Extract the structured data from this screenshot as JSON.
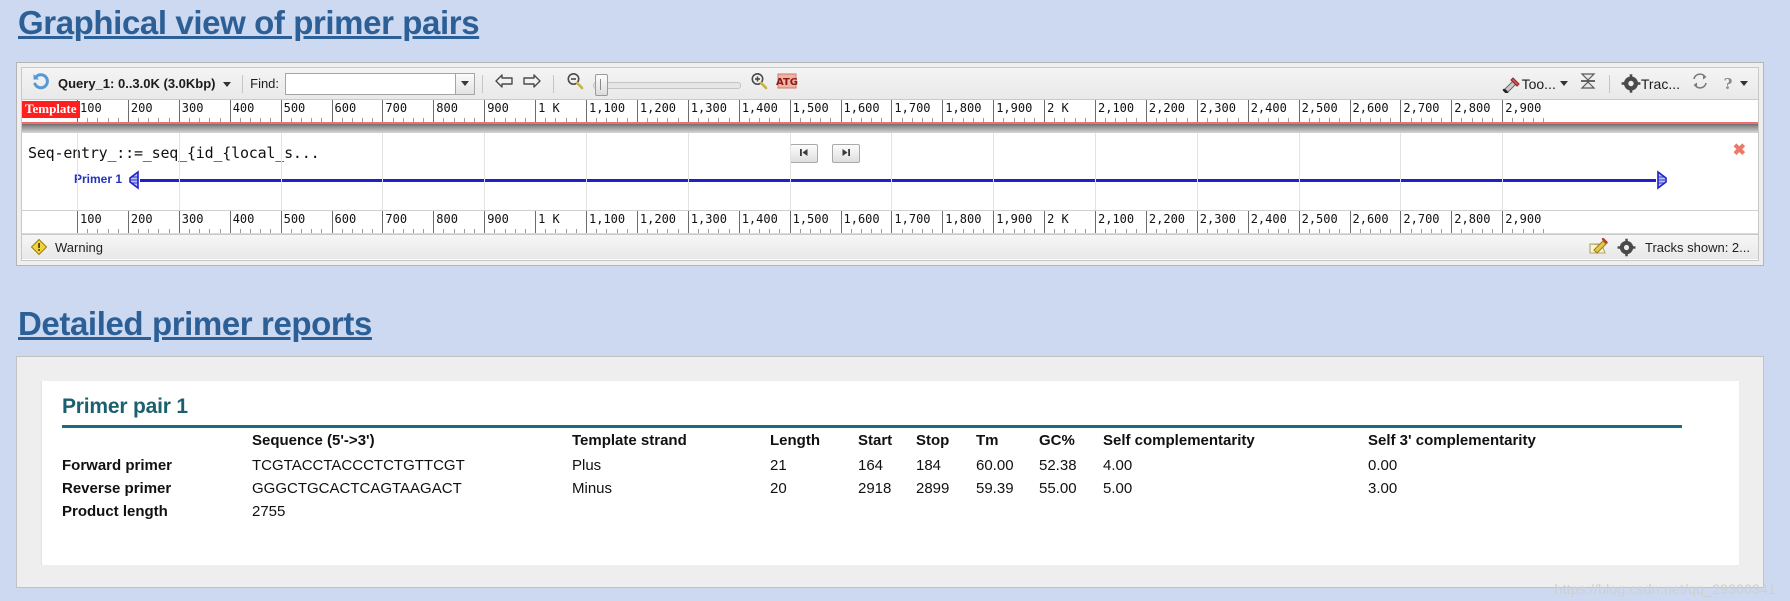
{
  "headings": {
    "graphical": "Graphical view of primer pairs",
    "reports": "Detailed primer reports"
  },
  "viewer": {
    "toolbar": {
      "back_icon": "undo-arrow-icon",
      "query_label": "Query_1: 0..3.0K (3.0Kbp)",
      "find_label": "Find:",
      "find_value": "",
      "find_placeholder": "",
      "prev_icon": "arrow-left-icon",
      "next_icon": "arrow-right-icon",
      "zoom_out_icon": "zoom-out-icon",
      "zoom_in_icon": "zoom-in-icon",
      "zoom_seq_icon": "atg-sequence-icon",
      "tools_label": "Too...",
      "tools_icon": "hammer-wrench-icon",
      "collapse_icon": "collapse-rows-icon",
      "tracks_label": "Trac...",
      "tracks_icon": "gear-icon",
      "reload_icon": "reload-icon",
      "help_icon": "question-mark-icon"
    },
    "ruler": {
      "template_badge": "Template",
      "ticks": [
        "100",
        "200",
        "300",
        "400",
        "500",
        "600",
        "700",
        "800",
        "900",
        "1 K",
        "1,100",
        "1,200",
        "1,300",
        "1,400",
        "1,500",
        "1,600",
        "1,700",
        "1,800",
        "1,900",
        "2 K",
        "2,100",
        "2,200",
        "2,300",
        "2,400",
        "2,500",
        "2,600",
        "2,700",
        "2,800",
        "2,900"
      ]
    },
    "graph": {
      "sequence_title": "Seq-entry_::=_seq_{id_{local_s...",
      "nav_first_icon": "step-backward-icon",
      "nav_next_icon": "step-forward-icon",
      "close_icon": "close-x-icon",
      "primer_label": "Primer 1",
      "primer_color": "#1f1fcc"
    },
    "statusbar": {
      "warning_icon": "warning-icon",
      "warning_label": "Warning",
      "edit_icon": "pencil-edit-icon",
      "settings_icon": "gear-icon",
      "tracks_shown": "Tracks shown: 2..."
    }
  },
  "report": {
    "pair_title": "Primer pair 1",
    "columns": [
      "",
      "Sequence (5'->3')",
      "Template strand",
      "Length",
      "Start",
      "Stop",
      "Tm",
      "GC%",
      "Self complementarity",
      "Self 3' complementarity"
    ],
    "rows": [
      {
        "label": "Forward primer",
        "sequence": "TCGTACCTACCCTCTGTTCGT",
        "strand": "Plus",
        "length": "21",
        "start": "164",
        "stop": "184",
        "tm": "60.00",
        "gc": "52.38",
        "self_comp": "4.00",
        "self3_comp": "0.00"
      },
      {
        "label": "Reverse primer",
        "sequence": "GGGCTGCACTCAGTAAGACT",
        "strand": "Minus",
        "length": "20",
        "start": "2918",
        "stop": "2899",
        "tm": "59.39",
        "gc": "55.00",
        "self_comp": "5.00",
        "self3_comp": "3.00"
      }
    ],
    "product_length_label": "Product length",
    "product_length_value": "2755"
  },
  "watermark": "https://blog.csdn.net/qq_29300341",
  "colors": {
    "heading": "#2c5f96",
    "page_bg": "#ccd9f0",
    "table_rule": "#176d7d",
    "pair_title": "#1c6070",
    "template_badge_bg": "#ff1f1f",
    "ruler_rule": "#f26d6d"
  }
}
